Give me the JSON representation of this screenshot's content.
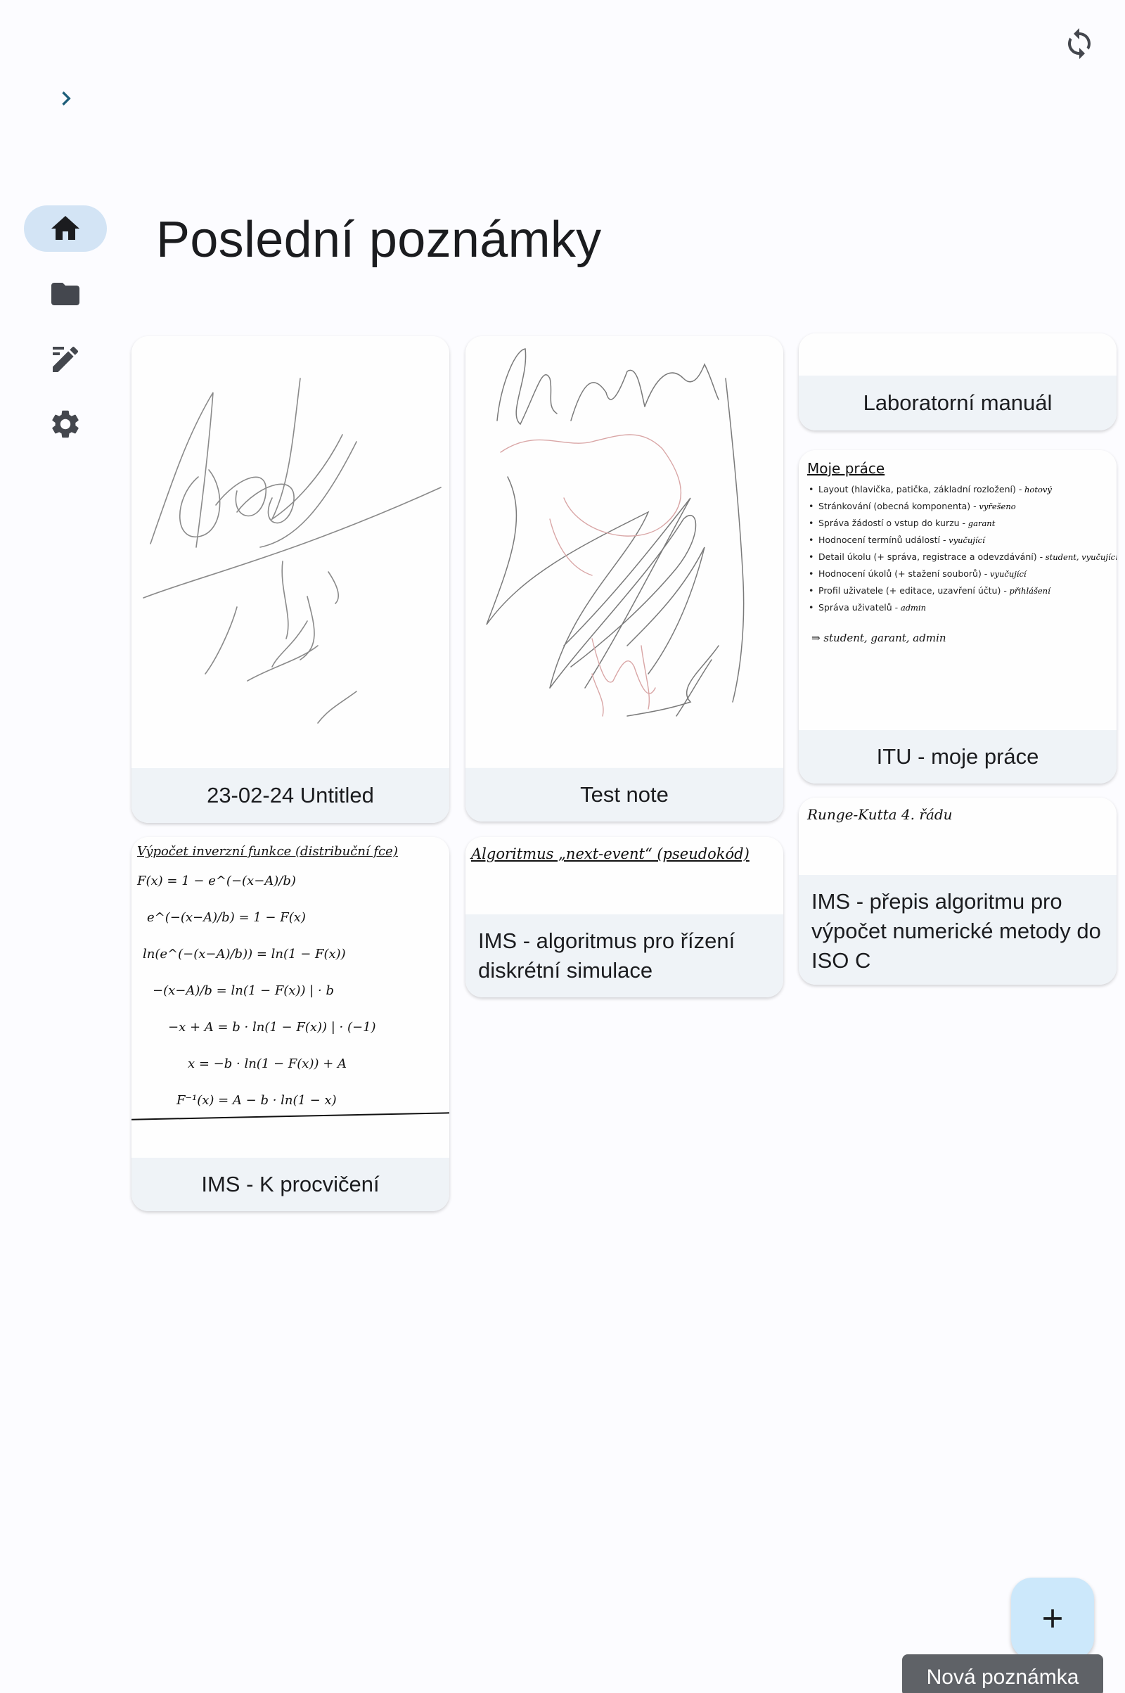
{
  "header": {
    "sync_icon": "sync-icon",
    "expand_icon": "chevron-right-icon"
  },
  "rail": {
    "items": [
      {
        "id": "home",
        "icon": "home-icon",
        "active": true
      },
      {
        "id": "folders",
        "icon": "folder-icon",
        "active": false
      },
      {
        "id": "notes",
        "icon": "edit-note-icon",
        "active": false
      },
      {
        "id": "settings",
        "icon": "gear-icon",
        "active": false
      }
    ]
  },
  "main": {
    "title": "Poslední poznámky",
    "notes": [
      {
        "title": "23-02-24 Untitled"
      },
      {
        "title": "Test note"
      },
      {
        "title": "Laboratorní manuál"
      },
      {
        "title": "ITU - moje práce",
        "preview": {
          "heading": "Moje práce",
          "bullets": [
            {
              "text": "Layout (hlavička, patička, základní rozložení) -",
              "note": "hotový"
            },
            {
              "text": "Stránkování (obecná komponenta) -",
              "note": "vyřešeno"
            },
            {
              "text": "Správa žádostí o vstup do kurzu -",
              "note": "garant"
            },
            {
              "text": "Hodnocení termínů událostí -",
              "note": "vyučující"
            },
            {
              "text": "Detail úkolu (+ správa, registrace a odevzdávání) -",
              "note": "student, vyučující"
            },
            {
              "text": "Hodnocení úkolů (+ stažení souborů) -",
              "note": "vyučující"
            },
            {
              "text": "Profil uživatele (+ editace, uzavření účtu) -",
              "note": "přihlášení"
            },
            {
              "text": "Správa uživatelů -",
              "note": "admin"
            }
          ],
          "footer": "⇒ student, garant, admin"
        }
      },
      {
        "title": "IMS - přepis algoritmu pro výpočet numerické metody do ISO C",
        "preview": {
          "line": "Runge-Kutta 4. řádu"
        }
      },
      {
        "title": "IMS - K procvičení",
        "preview": {
          "heading": "Výpočet inverzní funkce (distribuční fce)",
          "lines": [
            "F(x) = 1 − e^(−(x−A)/b)",
            "e^(−(x−A)/b) = 1 − F(x)",
            "ln(e^(−(x−A)/b)) = ln(1 − F(x))",
            "−(x−A)/b = ln(1 − F(x))   | · b",
            "−x + A = b · ln(1 − F(x))   | · (−1)",
            "x = −b · ln(1 − F(x)) + A",
            "F⁻¹(x) = A − b · ln(1 − x)"
          ]
        }
      },
      {
        "title": "IMS - algoritmus pro řízení diskrétní simulace",
        "preview": {
          "line": "Algoritmus „next-event“ (pseudokód)"
        }
      }
    ]
  },
  "fab": {
    "icon": "plus-icon",
    "tooltip": "Nová poznámka"
  },
  "colors": {
    "active_rail": "#d3e4f5",
    "caption_bg": "#eff3f7",
    "fab_bg": "#cce8fb",
    "icon": "#44474e",
    "accent_blue": "#3a9ad9"
  }
}
